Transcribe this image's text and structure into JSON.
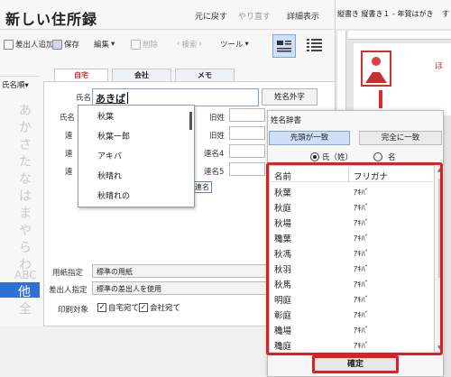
{
  "app": {
    "title": "新しい住所録",
    "undo": "元に戻す",
    "redo": "やり直す",
    "detail": "詳細表示"
  },
  "toolbar": {
    "add_sender": "差出人追加",
    "save": "保存",
    "edit": "編集",
    "delete": "削除",
    "search": "検索",
    "tools": "ツール"
  },
  "index": {
    "sort_label": "氏名順",
    "kana": [
      "あ",
      "か",
      "さ",
      "た",
      "な",
      "は",
      "ま",
      "や",
      "ら",
      "わ",
      "ABC",
      "他",
      "全"
    ],
    "selected": "他"
  },
  "tabs": [
    "自宅",
    "会社",
    "メモ"
  ],
  "form": {
    "name_label": "氏名",
    "name_value": "あきば",
    "name_gaiji_btn": "姓名外字",
    "row_labels": [
      "氏名",
      "連",
      "連",
      "連"
    ],
    "right_labels": [
      "旧姓",
      "旧姓",
      "連名4",
      "連名5"
    ],
    "chip": "連名",
    "paper_label": "用紙指定",
    "paper_value": "標準の用紙",
    "sender_label": "差出人指定",
    "sender_value": "標準の差出人を使用",
    "print_label": "印刷対象",
    "print_home": "自宅宛て",
    "print_work": "会社宛て"
  },
  "autocomplete": {
    "items": [
      "秋葉",
      "秋葉一郎",
      "アキバ",
      "秋晴れ",
      "秋晴れの"
    ]
  },
  "document": {
    "title": "縦書き 縦書き１ - 年賀はがき",
    "extra": "す",
    "side_text": "ほ"
  },
  "dictionary": {
    "title": "姓名辞書",
    "btn_prefix": "先頭が一致",
    "btn_exact": "完全に一致",
    "radio_surname": "氏（姓）",
    "radio_given": "名",
    "col_name": "名前",
    "col_kana": "フリガナ",
    "rows": [
      {
        "name": "秋葉",
        "kana": "ｱｷﾊﾞ"
      },
      {
        "name": "秋庭",
        "kana": "ｱｷﾊﾞ"
      },
      {
        "name": "秋場",
        "kana": "ｱｷﾊﾞ"
      },
      {
        "name": "穐葉",
        "kana": "ｱｷﾊﾞ"
      },
      {
        "name": "秋馮",
        "kana": "ｱｷﾊﾞ"
      },
      {
        "name": "秋羽",
        "kana": "ｱｷﾊﾞ"
      },
      {
        "name": "秋馬",
        "kana": "ｱｷﾊﾞ"
      },
      {
        "name": "明庭",
        "kana": "ｱｷﾊﾞ"
      },
      {
        "name": "彰庭",
        "kana": "ｱｷﾊﾞ"
      },
      {
        "name": "穐場",
        "kana": "ｱｷﾊﾞ"
      },
      {
        "name": "穐庭",
        "kana": "ｱｷﾊﾞ"
      }
    ],
    "confirm": "確定"
  },
  "colors": {
    "highlight_red": "#e02020",
    "selected_blue": "#2e6fd8",
    "accent_red": "#d43030"
  }
}
